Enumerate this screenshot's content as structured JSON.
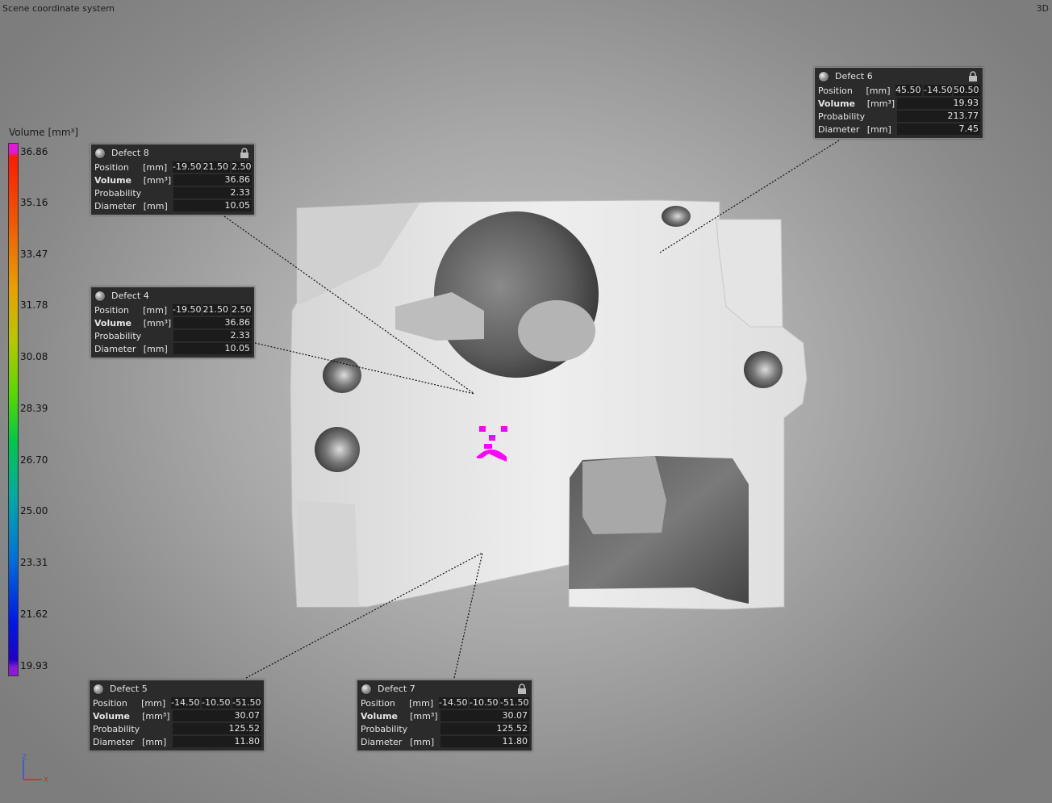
{
  "viewport": {
    "title": "Scene coordinate system",
    "mode": "3D"
  },
  "colors": {
    "defect_highlight": "#ff00ff",
    "panel_bg": "#2b2b2b"
  },
  "scale": {
    "title": "Volume [mm³]",
    "ticks": [
      "36.86",
      "35.16",
      "33.47",
      "31.78",
      "30.08",
      "28.39",
      "26.70",
      "25.00",
      "23.31",
      "21.62",
      "19.93"
    ]
  },
  "defects": {
    "d8": {
      "name": "Defect 8",
      "pos_label": "Position",
      "pos_unit": "[mm]",
      "pos": [
        "-19.50",
        "21.50",
        "2.50"
      ],
      "vol_label": "Volume",
      "vol_unit": "[mm³]",
      "vol": "36.86",
      "prob_label": "Probability",
      "prob": "2.33",
      "diam_label": "Diameter",
      "diam_unit": "[mm]",
      "diam": "10.05"
    },
    "d4": {
      "name": "Defect 4",
      "pos_label": "Position",
      "pos_unit": "[mm]",
      "pos": [
        "-19.50",
        "21.50",
        "2.50"
      ],
      "vol_label": "Volume",
      "vol_unit": "[mm³]",
      "vol": "36.86",
      "prob_label": "Probability",
      "prob": "2.33",
      "diam_label": "Diameter",
      "diam_unit": "[mm]",
      "diam": "10.05"
    },
    "d6": {
      "name": "Defect 6",
      "pos_label": "Position",
      "pos_unit": "[mm]",
      "pos": [
        "45.50",
        "-14.50",
        "50.50"
      ],
      "vol_label": "Volume",
      "vol_unit": "[mm³]",
      "vol": "19.93",
      "prob_label": "Probability",
      "prob": "213.77",
      "diam_label": "Diameter",
      "diam_unit": "[mm]",
      "diam": "7.45"
    },
    "d5": {
      "name": "Defect 5",
      "pos_label": "Position",
      "pos_unit": "[mm]",
      "pos": [
        "-14.50",
        "-10.50",
        "-51.50"
      ],
      "vol_label": "Volume",
      "vol_unit": "[mm³]",
      "vol": "30.07",
      "prob_label": "Probability",
      "prob": "125.52",
      "diam_label": "Diameter",
      "diam_unit": "[mm]",
      "diam": "11.80"
    },
    "d7": {
      "name": "Defect 7",
      "pos_label": "Position",
      "pos_unit": "[mm]",
      "pos": [
        "-14.50",
        "-10.50",
        "-51.50"
      ],
      "vol_label": "Volume",
      "vol_unit": "[mm³]",
      "vol": "30.07",
      "prob_label": "Probability",
      "prob": "125.52",
      "diam_label": "Diameter",
      "diam_unit": "[mm]",
      "diam": "11.80"
    }
  },
  "axes": {
    "z": "Z",
    "x": "X"
  }
}
